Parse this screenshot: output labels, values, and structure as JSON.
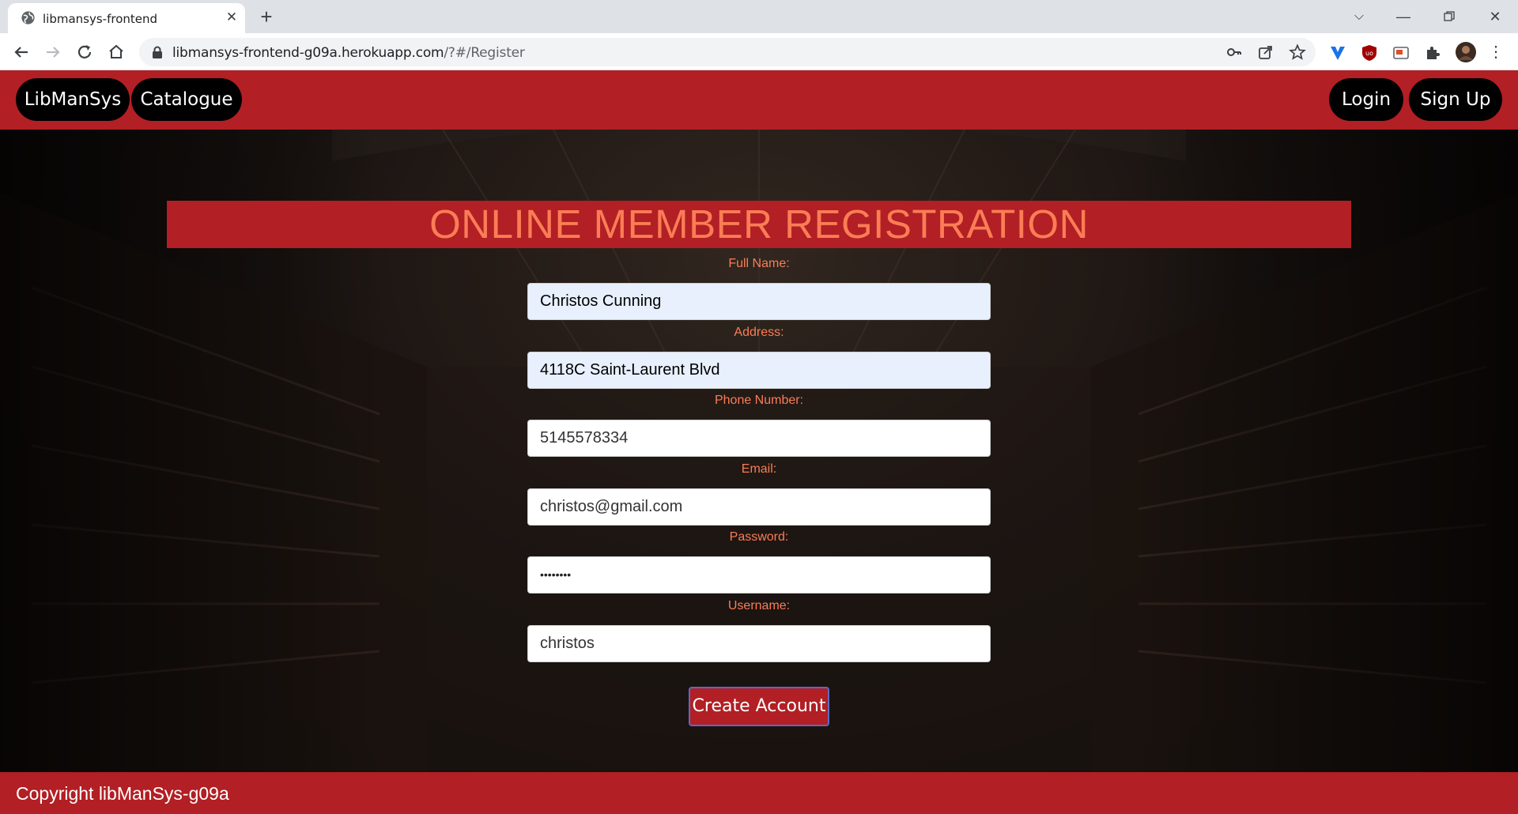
{
  "browser": {
    "tab_title": "libmansys-frontend",
    "url_host": "libmansys-frontend-g09a.herokuapp.com",
    "url_path": "/?#/Register"
  },
  "nav": {
    "brand": "LibManSys",
    "catalogue": "Catalogue",
    "login": "Login",
    "signup": "Sign Up"
  },
  "form": {
    "title": "ONLINE MEMBER REGISTRATION",
    "fields": [
      {
        "label": "Full Name:",
        "value": "Christos Cunning"
      },
      {
        "label": "Address:",
        "value": "4118C Saint-Laurent Blvd"
      },
      {
        "label": "Phone Number:",
        "value": "5145578334"
      },
      {
        "label": "Email:",
        "value": "christos@gmail.com"
      },
      {
        "label": "Password:",
        "value": "••••••••"
      },
      {
        "label": "Username:",
        "value": "christos"
      }
    ],
    "submit": "Create Account"
  },
  "footer": {
    "text": "Copyright libManSys-g09a"
  },
  "colors": {
    "brand_red": "#b21f24",
    "accent_orange": "#fa7d55",
    "autofill_blue": "#e8f0fe"
  }
}
